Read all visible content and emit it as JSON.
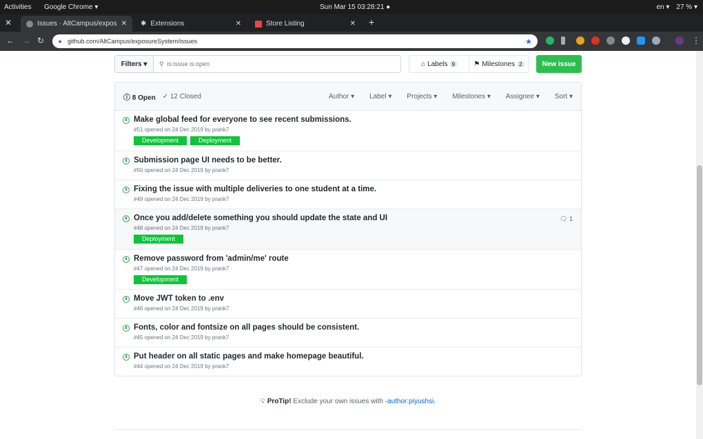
{
  "topbar": {
    "activities": "Activities",
    "app": "Google Chrome ▾",
    "clock": "Sun Mar 15  03:28:21 ●",
    "lang": "en ▾",
    "battery": "27 % ▾"
  },
  "tabs": [
    {
      "label": "Issues · AltCampus/expos"
    },
    {
      "label": "Extensions"
    },
    {
      "label": "Store Listing"
    }
  ],
  "address": {
    "url": "github.com/AltCampus/exposureSystem/issues"
  },
  "toolbar": {
    "filters": "Filters ▾",
    "search_value": "is:issue is:open",
    "labels": "Labels",
    "labels_count": "9",
    "milestones": "Milestones",
    "milestones_count": "2",
    "new_issue": "New issue"
  },
  "list_header": {
    "open": "8 Open",
    "closed": "12 Closed",
    "filters": [
      "Author ▾",
      "Label ▾",
      "Projects ▾",
      "Milestones ▾",
      "Assignee ▾",
      "Sort ▾"
    ]
  },
  "issues": [
    {
      "title": "Make global feed for everyone to see recent submissions.",
      "meta": "#51 opened on 24 Dec 2019 by prank7",
      "labels": [
        "Development",
        "Deployment"
      ]
    },
    {
      "title": "Submission page UI needs to be better.",
      "meta": "#50 opened on 24 Dec 2019 by prank7",
      "labels": []
    },
    {
      "title": "Fixing the issue with multiple deliveries to one student at a time.",
      "meta": "#49 opened on 24 Dec 2019 by prank7",
      "labels": []
    },
    {
      "title": "Once you add/delete something you should update the state and UI",
      "meta": "#48 opened on 24 Dec 2019 by prank7",
      "labels": [
        "Deployment"
      ],
      "comments": "1"
    },
    {
      "title": "Remove password from 'admin/me' route",
      "meta": "#47 opened on 24 Dec 2019 by prank7",
      "labels": [
        "Development"
      ]
    },
    {
      "title": "Move JWT token to .env",
      "meta": "#46 opened on 24 Dec 2019 by prank7",
      "labels": []
    },
    {
      "title": "Fonts, color and fontsize on all pages should be consistent.",
      "meta": "#45 opened on 24 Dec 2019 by prank7",
      "labels": []
    },
    {
      "title": "Put header on all static pages and make homepage beautiful.",
      "meta": "#44 opened on 24 Dec 2019 by prank7",
      "labels": []
    }
  ],
  "protip": {
    "label": "ProTip!",
    "text": " Exclude your own issues with ",
    "link": "-author:piyushsi."
  },
  "colors": {
    "green": "#2cbe4e",
    "label": "#0fc43a",
    "link": "#0366d6"
  }
}
